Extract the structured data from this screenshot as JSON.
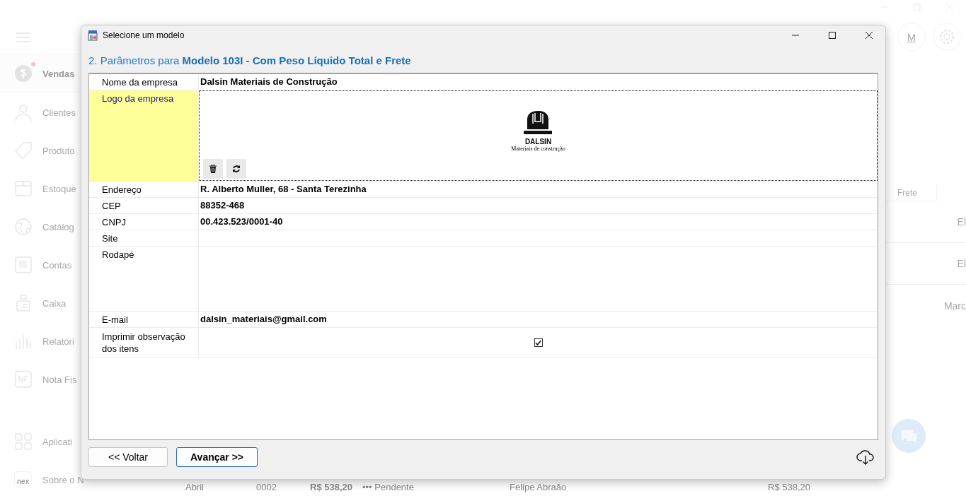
{
  "app": {
    "sidebar": [
      {
        "label": "Vendas",
        "selected": true,
        "badge": true
      },
      {
        "label": "Clientes",
        "selected": false,
        "badge": false
      },
      {
        "label": "Produto",
        "selected": false,
        "badge": false
      },
      {
        "label": "Estoque",
        "selected": false,
        "badge": false
      },
      {
        "label": "Catálog",
        "selected": false,
        "badge": false
      },
      {
        "label": "Contas",
        "selected": false,
        "badge": false
      },
      {
        "label": "Caixa",
        "selected": false,
        "badge": false
      },
      {
        "label": "Relatóri",
        "selected": false,
        "badge": false
      },
      {
        "label": "Nota Fis",
        "selected": false,
        "badge": false
      },
      {
        "label": "Aplicati",
        "selected": false,
        "badge": false
      },
      {
        "label": "Sobre o N",
        "selected": false,
        "badge": false
      }
    ],
    "avatar": "M",
    "nex_logo": "nex",
    "table_header": "Frete",
    "right_cells": [
      "El",
      "El",
      "Marc"
    ],
    "bottom_row": [
      "Abril",
      "0002",
      "R$ 538,20",
      "••• Pendente",
      "Felipe Abraão",
      "R$ 538,20"
    ]
  },
  "dialog": {
    "title": "Selecione um modelo",
    "heading": "2. Parâmetros para **Modelo 103I - Com Peso Líquido Total e Frete**",
    "fields": [
      {
        "kind": "text",
        "label": "Nome da empresa",
        "value": "Dalsin Materiais de Construção",
        "selected": false
      },
      {
        "kind": "image",
        "label": "Logo da empresa",
        "logo_name": "DALSIN",
        "logo_tagline": "Materiais de construção",
        "selected": true
      },
      {
        "kind": "text",
        "label": "Endereço",
        "value": "R. Alberto Muller, 68 - Santa Terezinha",
        "selected": false
      },
      {
        "kind": "text",
        "label": "CEP",
        "value": "88352-468",
        "selected": false
      },
      {
        "kind": "text",
        "label": "CNPJ",
        "value": "00.423.523/0001-40",
        "selected": false
      },
      {
        "kind": "text",
        "label": "Site",
        "selected": false
      },
      {
        "kind": "multiline",
        "label": "Rodapé",
        "selected": false
      },
      {
        "kind": "text",
        "label": "E-mail",
        "value": "dalsin_materiais@gmail.com",
        "selected": false
      },
      {
        "kind": "checkbox",
        "label": "Imprimir observação dos itens",
        "checked": true,
        "selected": false
      }
    ],
    "back_button": "<< Voltar",
    "next_button": "Avançar >>"
  }
}
